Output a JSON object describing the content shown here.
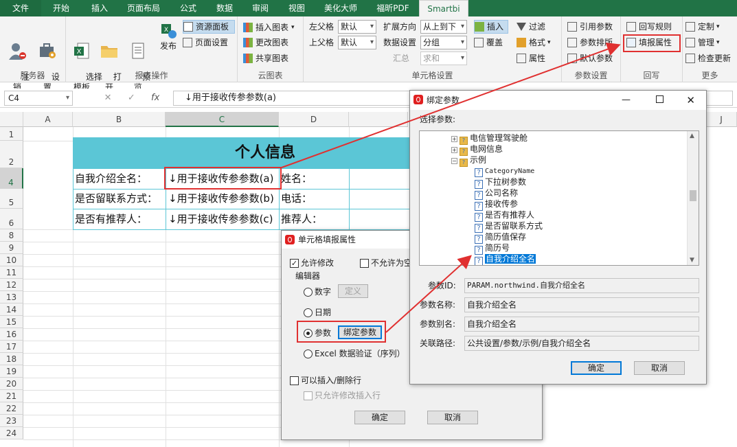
{
  "tabs": [
    "文件",
    "开始",
    "插入",
    "页面布局",
    "公式",
    "数据",
    "审阅",
    "视图",
    "美化大师",
    "福昕PDF",
    "Smartbi"
  ],
  "ribbon": {
    "server": {
      "label": "服务器",
      "logout": "注\n销",
      "settings": "设\n置"
    },
    "report": {
      "label": "报表操作",
      "choose": "选择\n模板",
      "open": "打\n开",
      "preview": "预\n览",
      "publish": "发布",
      "resource": "资源面板",
      "page_setup": "页面设置"
    },
    "cloud": {
      "label": "云图表",
      "insert_chart": "插入图表",
      "change_chart": "更改图表",
      "share_chart": "共享图表"
    },
    "cellset": {
      "label": "单元格设置",
      "left_parent": "左父格",
      "left_value": "默认",
      "top_parent": "上父格",
      "top_value": "默认",
      "expand_dir": "扩展方向",
      "expand_value": "从上到下",
      "data_setting": "数据设置",
      "data_value": "分组",
      "summary": "汇总",
      "summary_value": "求和",
      "insert": "插入",
      "cover": "覆盖",
      "filter": "过滤",
      "format": "格式",
      "attr": "属性"
    },
    "params": {
      "label": "参数设置",
      "ref": "引用参数",
      "layout": "参数排版",
      "default": "默认参数"
    },
    "writeback": {
      "label": "回写",
      "rule": "回写规则",
      "fill": "填报属性"
    },
    "more": {
      "label": "更多",
      "custom": "定制",
      "manage": "管理",
      "update": "检查更新"
    }
  },
  "formula": {
    "namebox": "C4",
    "content": "↓用于接收传参参数(a)"
  },
  "columns": [
    "A",
    "B",
    "C",
    "D",
    "J"
  ],
  "rows": [
    "1",
    "2",
    "4",
    "5",
    "6",
    "8",
    "9",
    "10",
    "11",
    "12",
    "13",
    "14",
    "15",
    "16",
    "17",
    "18",
    "19",
    "20",
    "21",
    "22",
    "23",
    "24"
  ],
  "sheet": {
    "title": "个人信息",
    "r4": {
      "b": "自我介绍全名：",
      "c": "↓用于接收传参参数(a)",
      "d": "姓名："
    },
    "r5": {
      "b": "是否留联系方式：",
      "c": "↓用于接收传参参数(b)",
      "d": "电话："
    },
    "r6": {
      "b": "是否有推荐人：",
      "c": "↓用于接收传参参数(c)",
      "d": "推荐人："
    }
  },
  "fill_dialog": {
    "title": "单元格填报属性",
    "allow_edit": "允许修改",
    "not_null": "不允许为空",
    "editor": "编辑器",
    "number": "数字",
    "define": "定义",
    "date": "日期",
    "param": "参数",
    "bind_param": "绑定参数",
    "excel_validate": "Excel 数据验证（序列）",
    "can_insert": "可以插入/删除行",
    "only_insert": "只允许修改插入行",
    "ok": "确定",
    "cancel": "取消"
  },
  "bind_dialog": {
    "title": "绑定参数",
    "select_label": "选择参数:",
    "tree": [
      "电信管理驾驶舱",
      "电网信息",
      "示例",
      "CategoryName",
      "下拉树参数",
      "公司名称",
      "接收传参",
      "是否有推荐人",
      "是否留联系方式",
      "简历值保存",
      "简历号",
      "自我介绍全名"
    ],
    "param_id_label": "参数ID:",
    "param_id": "PARAM.northwind.自我介绍全名",
    "param_name_label": "参数名称:",
    "param_name": "自我介绍全名",
    "param_alias_label": "参数别名:",
    "param_alias": "自我介绍全名",
    "path_label": "关联路径:",
    "path": "公共设置/参数/示例/自我介绍全名",
    "ok": "确定",
    "cancel": "取消"
  },
  "colors": {
    "excel_green": "#217346",
    "title_fill": "#5bc6d6",
    "highlight_red": "#e03030"
  }
}
